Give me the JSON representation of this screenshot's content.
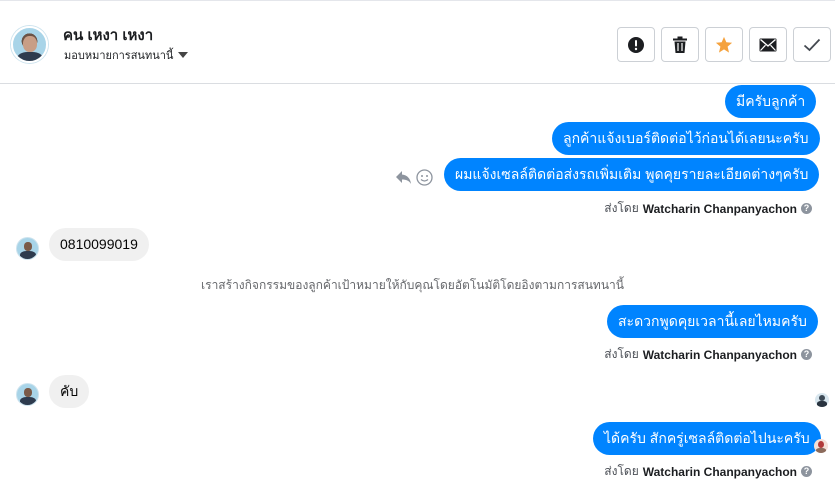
{
  "header": {
    "contact_name": "คน เหงา เหงา",
    "assign_label": "มอบหมายการสนทนานี้",
    "actions": [
      {
        "name": "alert-button",
        "icon": "exclamation-circle-icon"
      },
      {
        "name": "delete-button",
        "icon": "trash-icon"
      },
      {
        "name": "star-button",
        "icon": "star-icon",
        "color": "#f5a23d"
      },
      {
        "name": "mail-button",
        "icon": "envelope-icon"
      },
      {
        "name": "done-button",
        "icon": "checkmark-icon"
      }
    ]
  },
  "messages": {
    "out1": "มีครับลูกค้า",
    "out2": "ลูกค้าแจ้งเบอร์ติดต่อไว้ก่อนได้เลยนะครับ",
    "out3": "ผมแจ้งเซลล์ติดต่อส่งรถเพิ่มเติม พูดคุยรายละเอียดต่างๆครับ",
    "in1": "0810099019",
    "system": "เราสร้างกิจกรรมของลูกค้าเป้าหมายให้กับคุณโดยอัตโนมัติโดยอิงตามการสนทนานี้",
    "out4": "สะดวกพูดคุยเวลานี้เลยไหมครับ",
    "in2": "คับ",
    "out5": "ได้ครับ สักครู่เซลล์ติดต่อไปนะครับ"
  },
  "sent_by": {
    "prefix": "ส่งโดย",
    "agent": "Watcharin Chanpanyachon",
    "help_icon": "?"
  },
  "colors": {
    "outgoing_bubble": "#0084ff",
    "incoming_bubble": "#f0f0f0",
    "star": "#f5a23d"
  }
}
